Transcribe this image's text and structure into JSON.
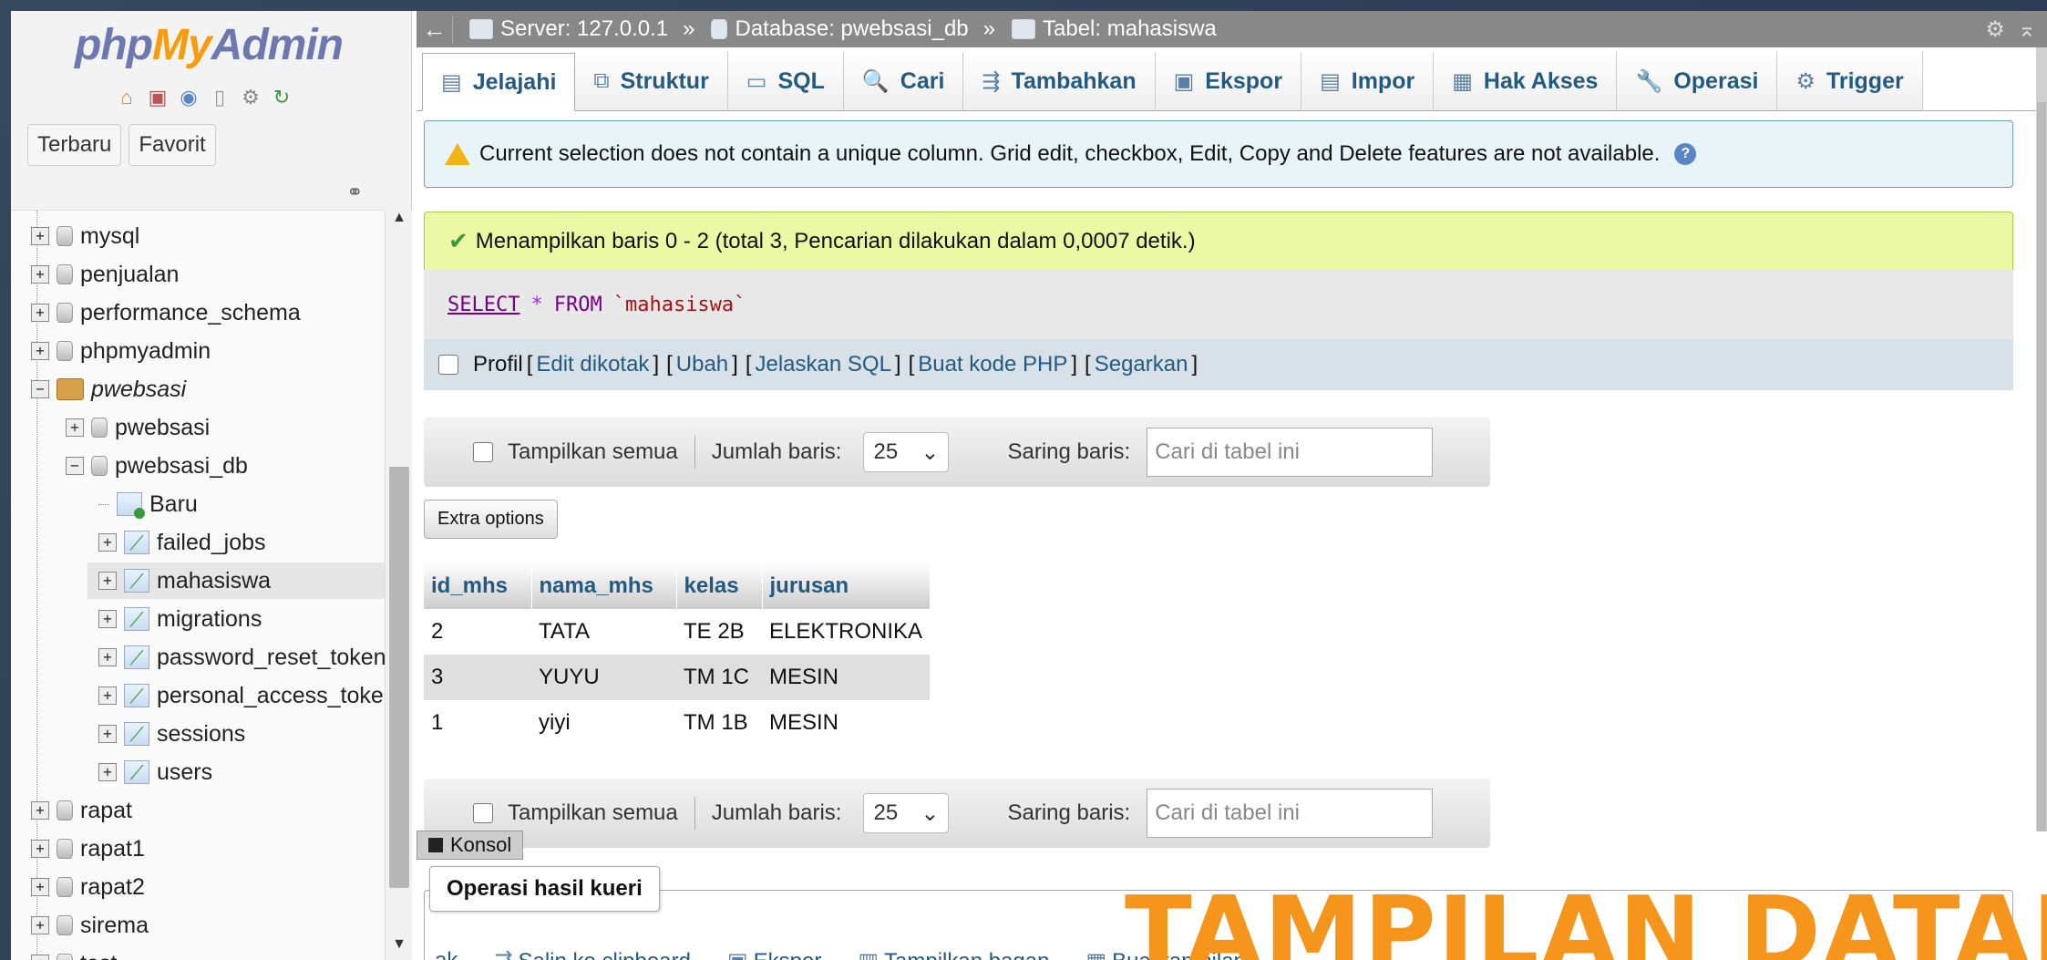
{
  "logo": {
    "php": "php",
    "my": "My",
    "admin": "Admin"
  },
  "sidebar": {
    "recent_label": "Terbaru",
    "favorite_label": "Favorit",
    "tree": [
      {
        "label": "mysql",
        "level": 0,
        "type": "db",
        "expander": "+"
      },
      {
        "label": "penjualan",
        "level": 0,
        "type": "db",
        "expander": "+"
      },
      {
        "label": "performance_schema",
        "level": 0,
        "type": "db",
        "expander": "+"
      },
      {
        "label": "phpmyadmin",
        "level": 0,
        "type": "db",
        "expander": "+"
      },
      {
        "label": "pwebsasi",
        "level": 0,
        "type": "folder",
        "expander": "−"
      },
      {
        "label": "pwebsasi",
        "level": 1,
        "type": "db",
        "expander": "+"
      },
      {
        "label": "pwebsasi_db",
        "level": 1,
        "type": "db",
        "expander": "−"
      },
      {
        "label": "Baru",
        "level": 2,
        "type": "new",
        "expander": ""
      },
      {
        "label": "failed_jobs",
        "level": 2,
        "type": "table",
        "expander": "+"
      },
      {
        "label": "mahasiswa",
        "level": 2,
        "type": "table",
        "expander": "+"
      },
      {
        "label": "migrations",
        "level": 2,
        "type": "table",
        "expander": "+"
      },
      {
        "label": "password_reset_tokens",
        "level": 2,
        "type": "table",
        "expander": "+"
      },
      {
        "label": "personal_access_tokens",
        "level": 2,
        "type": "table",
        "expander": "+"
      },
      {
        "label": "sessions",
        "level": 2,
        "type": "table",
        "expander": "+"
      },
      {
        "label": "users",
        "level": 2,
        "type": "table",
        "expander": "+"
      },
      {
        "label": "rapat",
        "level": 0,
        "type": "db",
        "expander": "+"
      },
      {
        "label": "rapat1",
        "level": 0,
        "type": "db",
        "expander": "+"
      },
      {
        "label": "rapat2",
        "level": 0,
        "type": "db",
        "expander": "+"
      },
      {
        "label": "sirema",
        "level": 0,
        "type": "db",
        "expander": "+"
      },
      {
        "label": "test",
        "level": 0,
        "type": "db",
        "expander": "+"
      }
    ]
  },
  "topbar": {
    "server": "Server: 127.0.0.1",
    "database": "Database: pwebsasi_db",
    "table": "Tabel: mahasiswa",
    "sep": "»"
  },
  "tabs": [
    {
      "label": "Jelajahi",
      "icon": "▤"
    },
    {
      "label": "Struktur",
      "icon": "⧉"
    },
    {
      "label": "SQL",
      "icon": "▭"
    },
    {
      "label": "Cari",
      "icon": "🔍"
    },
    {
      "label": "Tambahkan",
      "icon": "⇶"
    },
    {
      "label": "Ekspor",
      "icon": "▣"
    },
    {
      "label": "Impor",
      "icon": "▤"
    },
    {
      "label": "Hak Akses",
      "icon": "▦"
    },
    {
      "label": "Operasi",
      "icon": "🔧"
    },
    {
      "label": "Trigger",
      "icon": "⚙"
    }
  ],
  "notice": {
    "text": "Current selection does not contain a unique column. Grid edit, checkbox, Edit, Copy and Delete features are not available."
  },
  "success": {
    "text": "Menampilkan baris 0 - 2 (total 3, Pencarian dilakukan dalam 0,0007 detik.)"
  },
  "sql": {
    "select": "SELECT",
    "star": "*",
    "from": "FROM",
    "table": "`mahasiswa`"
  },
  "profil": {
    "label": "Profil",
    "links": [
      "Edit dikotak",
      "Ubah",
      "Jelaskan SQL",
      "Buat kode PHP",
      "Segarkan"
    ]
  },
  "navbar": {
    "show_all": "Tampilkan semua",
    "rows_label": "Jumlah baris:",
    "rows_value": "25",
    "filter_label": "Saring baris:",
    "filter_placeholder": "Cari di tabel ini"
  },
  "extra_options": "Extra options",
  "results": {
    "columns": [
      "id_mhs",
      "nama_mhs",
      "kelas",
      "jurusan"
    ],
    "rows": [
      [
        "2",
        "TATA",
        "TE 2B",
        "ELEKTRONIKA"
      ],
      [
        "3",
        "YUYU",
        "TM 1C",
        "MESIN"
      ],
      [
        "1",
        "yiyi",
        "TM 1B",
        "MESIN"
      ]
    ]
  },
  "query_ops": {
    "legend": "Operasi hasil kueri",
    "items": [
      "ak",
      "Salin ke clipboard",
      "Ekspor",
      "Tampilkan bagan",
      "Buat tampilan"
    ]
  },
  "console": "Konsol",
  "watermark": "TAMPILAN DATAB",
  "colors": {
    "accent": "#235a81",
    "watermark": "#f5951c",
    "success_bg": "#ebf8a4",
    "notice_bg": "#e8f4f8"
  }
}
